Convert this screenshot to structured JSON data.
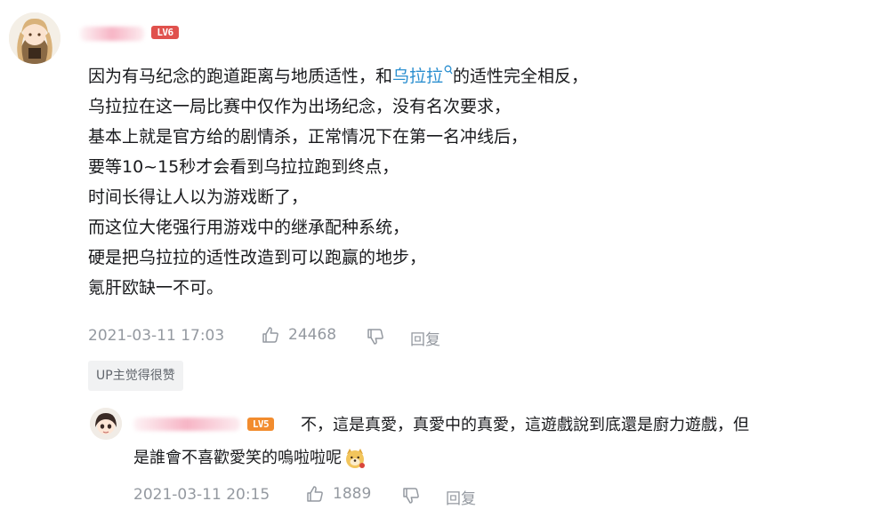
{
  "comment": {
    "user": {
      "level_badge": "LV6"
    },
    "lines": [
      {
        "before": "因为有马纪念的跑道距离与地质适性，和",
        "link": "乌拉拉",
        "after": "的适性完全相反，"
      },
      {
        "before": "乌拉拉在这一局比赛中仅作为出场纪念，没有名次要求，",
        "link": "",
        "after": ""
      },
      {
        "before": "基本上就是官方给的剧情杀，正常情况下在第一名冲线后，",
        "link": "",
        "after": ""
      },
      {
        "before": "要等10~15秒才会看到乌拉拉跑到终点，",
        "link": "",
        "after": ""
      },
      {
        "before": "时间长得让人以为游戏断了，",
        "link": "",
        "after": ""
      },
      {
        "before": "而这位大佬强行用游戏中的继承配种系统，",
        "link": "",
        "after": ""
      },
      {
        "before": "硬是把乌拉拉的适性改造到可以跑赢的地步，",
        "link": "",
        "after": ""
      },
      {
        "before": "氪肝欧缺一不可。",
        "link": "",
        "after": ""
      }
    ],
    "timestamp": "2021-03-11 17:03",
    "like_count": "24468",
    "reply_label": "回复",
    "up_badge": "UP主觉得很赞",
    "link_search_icon": "search-icon"
  },
  "reply": {
    "user": {
      "level_badge": "LV5"
    },
    "line1": "不，這是真愛，真愛中的真愛，這遊戲說到底還是廚力遊戲，但",
    "line2": "是誰會不喜歡愛笑的嗚啦啦呢",
    "emoji": "doge-emoji",
    "timestamp": "2021-03-11 20:15",
    "like_count": "1889",
    "reply_label": "回复"
  },
  "colors": {
    "link": "#2b8fd0",
    "meta": "#9499a0",
    "lv6": "#e0514d",
    "lv5": "#f28c2e"
  }
}
